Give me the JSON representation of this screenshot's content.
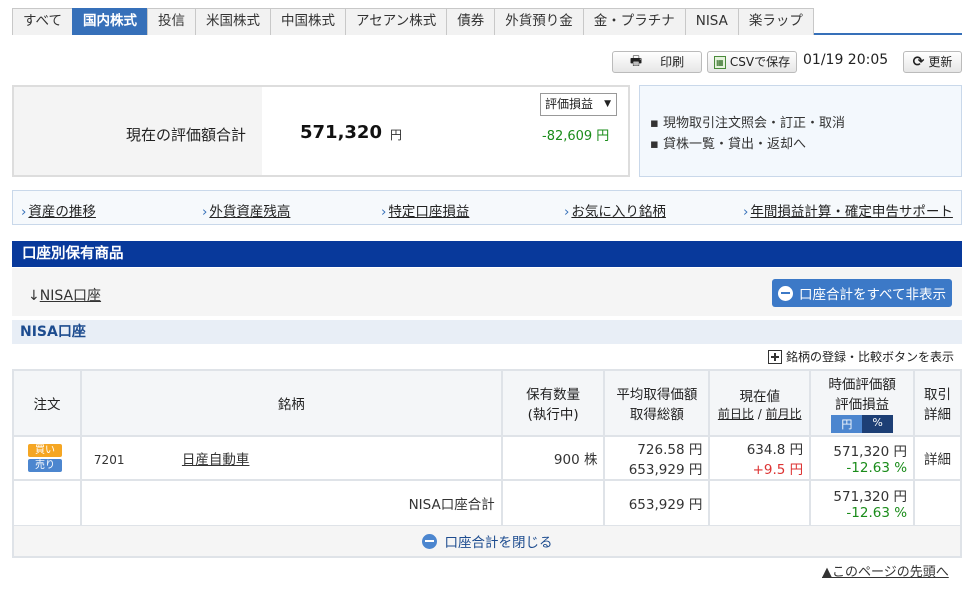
{
  "tabs": [
    "すべて",
    "国内株式",
    "投信",
    "米国株式",
    "中国株式",
    "アセアン株式",
    "債券",
    "外貨預り金",
    "金・プラチナ",
    "NISA",
    "楽ラップ"
  ],
  "active_tab": 1,
  "toolbar": {
    "print_label": "印刷",
    "csv_label": "CSVで保存",
    "timestamp": "01/19 20:05",
    "refresh_label": "更新"
  },
  "valuation": {
    "label": "現在の評価額合計",
    "amount": "571,320",
    "unit": "円",
    "select_label": "評価損益",
    "change": "-82,609 円"
  },
  "side_links": [
    "現物取引注文照会・訂正・取消",
    "貸株一覧・貸出・返却へ"
  ],
  "link_bar": [
    "資産の推移",
    "外貨資産残高",
    "特定口座損益",
    "お気に入り銘柄",
    "年間損益計算・確定申告サポート"
  ],
  "section_title": "口座別保有商品",
  "account": {
    "anchor_arrow": "↓",
    "anchor_label": "NISA口座",
    "hide_all_label": "口座合計をすべて非表示",
    "heading": "NISA口座",
    "register_label": "銘柄の登録・比較ボタンを表示"
  },
  "table": {
    "headers": {
      "order": "注文",
      "name": "銘柄",
      "qty": "保有数量",
      "qty_sub": "(執行中)",
      "avg": "平均取得価額",
      "avg_sub": "取得総額",
      "price": "現在値",
      "price_sub_a": "前日比",
      "price_sub_sep": " / ",
      "price_sub_b": "前月比",
      "value": "時価評価額",
      "value_sub": "評価損益",
      "toggle_yen": "円",
      "toggle_pct": "%",
      "detail": "取引",
      "detail_sub": "詳細"
    },
    "rows": [
      {
        "buy": "買い",
        "sell": "売り",
        "code": "7201",
        "name": "日産自動車",
        "qty": "900 株",
        "avg": "726.58 円",
        "total": "653,929 円",
        "price": "634.8 円",
        "change": "+9.5 円",
        "value": "571,320 円",
        "pl": "-12.63 %",
        "detail": "詳細"
      }
    ],
    "total": {
      "label": "NISA口座合計",
      "total": "653,929 円",
      "value": "571,320 円",
      "pl": "-12.63 %"
    }
  },
  "close_label": "口座合計を閉じる",
  "page_top": "▲このページの先頭へ"
}
